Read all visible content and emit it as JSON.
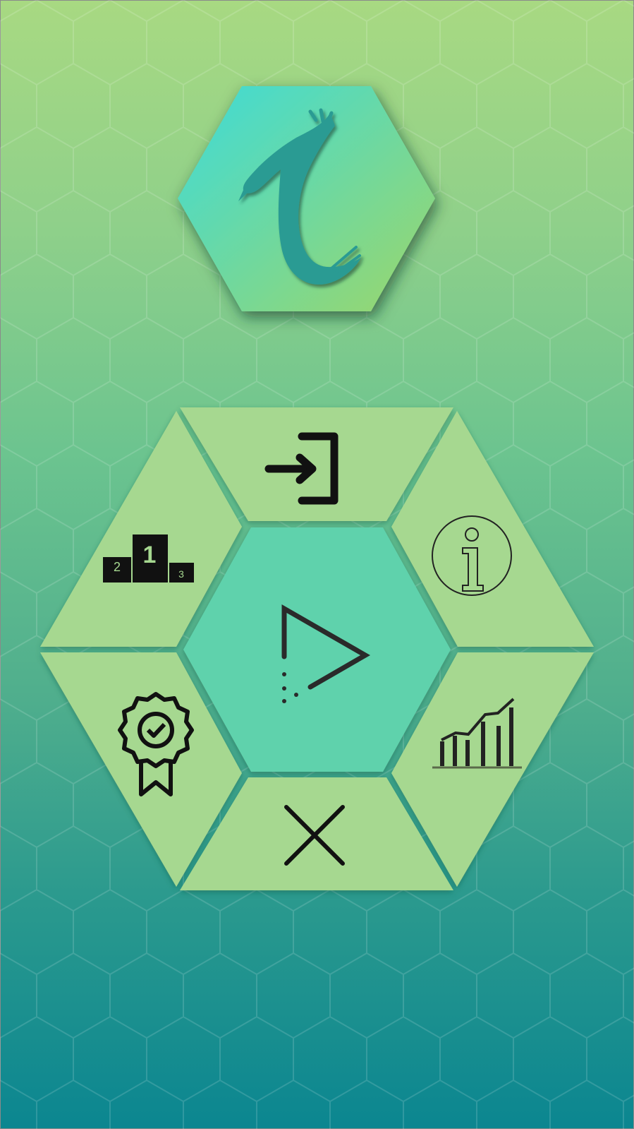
{
  "theme": {
    "logo_gradient_start": "#3edbd8",
    "logo_gradient_end": "#9cd66a",
    "logo_glyph": "#2a9b93",
    "outer_segment": "#a6d890",
    "center_segment": "#5fd2ac",
    "icon_dark": "#111111"
  },
  "menu": {
    "center": {
      "icon": "play-icon"
    },
    "top": {
      "icon": "login-icon"
    },
    "top_right": {
      "icon": "info-icon"
    },
    "bottom_right": {
      "icon": "stats-chart-icon"
    },
    "bottom": {
      "icon": "close-icon"
    },
    "bottom_left": {
      "icon": "award-badge-icon"
    },
    "top_left": {
      "icon": "podium-icon",
      "podium_first": "1",
      "podium_second": "2",
      "podium_third": "3"
    }
  }
}
